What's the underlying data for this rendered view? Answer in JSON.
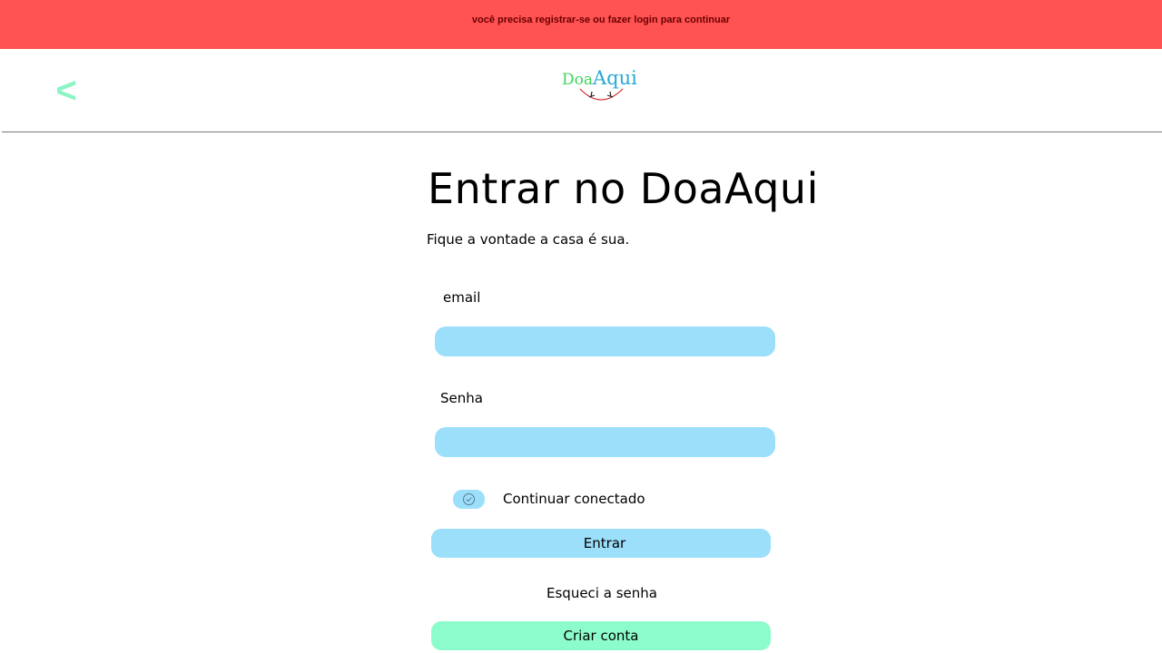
{
  "banner": {
    "message": "você precisa registrar-se ou fazer login para continuar",
    "color": "#ff5252"
  },
  "header": {
    "back_label": "<",
    "logo": {
      "part1": "Doa",
      "part2": "Aqui"
    }
  },
  "main": {
    "title": "Entrar no DoaAqui",
    "subtitle": "Fique a vontade a casa é sua.",
    "email_label": "email",
    "email_value": "",
    "password_label": "Senha",
    "password_value": "",
    "remember_label": "Continuar conectado",
    "login_label": "Entrar",
    "forgot_label": "Esqueci a senha",
    "create_account_label": "Criar conta"
  },
  "colors": {
    "input_bg": "#9bdffb",
    "accent_green": "#8cfccc",
    "back_arrow": "#8cf5c5"
  },
  "icons": [
    "back-arrow-icon",
    "check-icon",
    "logo-smile-icon"
  ]
}
